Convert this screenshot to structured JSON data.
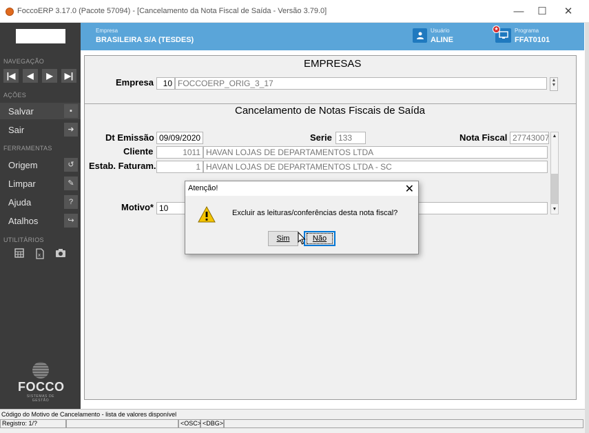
{
  "window": {
    "title": "FoccoERP 3.17.0 (Pacote 57094) - [Cancelamento da Nota Fiscal de Saída - Versão 3.79.0]",
    "minimize": "—",
    "maximize": "☐",
    "close": "✕"
  },
  "sidebar": {
    "navegacao_title": "NAVEGAÇÃO",
    "nav_buttons": [
      "|◀",
      "◀",
      "▶",
      "▶|"
    ],
    "acoes_title": "AÇÕES",
    "acoes": [
      {
        "label": "Salvar",
        "icon": "save-icon",
        "glyph": "▪"
      },
      {
        "label": "Sair",
        "icon": "exit-icon",
        "glyph": "➜"
      }
    ],
    "ferramentas_title": "FERRAMENTAS",
    "ferramentas": [
      {
        "label": "Origem",
        "icon": "undo-icon",
        "glyph": "↺"
      },
      {
        "label": "Limpar",
        "icon": "eraser-icon",
        "glyph": "✎"
      },
      {
        "label": "Ajuda",
        "icon": "help-icon",
        "glyph": "?"
      },
      {
        "label": "Atalhos",
        "icon": "shortcut-icon",
        "glyph": "↪"
      }
    ],
    "utilitarios_title": "UTILITÁRIOS",
    "utilitarios_icons": [
      "calculator-icon",
      "excel-icon",
      "camera-icon"
    ],
    "logo": {
      "name": "FOCCO",
      "tagline": "SISTEMAS DE GESTÃO"
    }
  },
  "header": {
    "empresa_label": "Empresa",
    "empresa_value": "BRASILEIRA S/A (TESDES)",
    "usuario_label": "Usuário",
    "usuario_value": "ALINE",
    "programa_label": "Programa",
    "programa_value": "FFAT0101",
    "accent_color": "#5aa5d9"
  },
  "form": {
    "empresas_heading": "EMPRESAS",
    "empresa_label": "Empresa",
    "empresa_code": "10",
    "empresa_name": "FOCCOERP_ORIG_3_17",
    "cancel_heading": "Cancelamento de Notas Fiscais de Saída",
    "dt_emissao_label": "Dt Emissão",
    "dt_emissao_value": "09/09/2020",
    "serie_label": "Serie",
    "serie_value": "133",
    "nota_fiscal_label": "Nota Fiscal",
    "nota_fiscal_value": "27743007",
    "cliente_label": "Cliente",
    "cliente_code": "1011",
    "cliente_name": "HAVAN LOJAS DE DEPARTAMENTOS LTDA",
    "estab_label": "Estab. Faturam.",
    "estab_code": "1",
    "estab_name": "HAVAN LOJAS DE DEPARTAMENTOS LTDA - SC",
    "motivo_label": "Motivo*",
    "motivo_code": "10"
  },
  "dialog": {
    "title": "Atenção!",
    "message": "Excluir as leituras/conferências desta nota fiscal?",
    "yes_label": "Sim",
    "no_label": "Não",
    "close": "✕"
  },
  "statusbar": {
    "message": "Código do Motivo de Cancelamento - lista de valores disponível",
    "registro": "Registro: 1/?",
    "osc": "<OSC>",
    "dbg": "<DBG>"
  }
}
